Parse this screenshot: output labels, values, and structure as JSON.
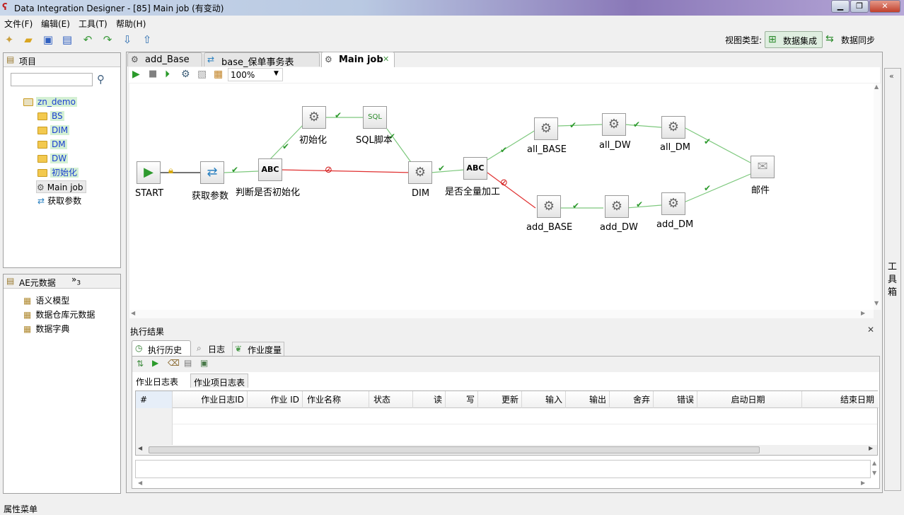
{
  "window": {
    "title": "Data Integration Designer - [85] Main job (有变动)",
    "minimize": "▁",
    "maximize": "❐",
    "close": "✕"
  },
  "menu": [
    "文件(F)",
    "编辑(E)",
    "工具(T)",
    "帮助(H)"
  ],
  "toolbar": {
    "view_type_label": "视图类型:",
    "view_integration": "数据集成",
    "view_sync": "数据同步"
  },
  "project_panel": {
    "title": "项目",
    "search_placeholder": "",
    "root": "zn_demo",
    "items": [
      "BS",
      "DIM",
      "DM",
      "DW",
      "初始化",
      "Main job",
      "获取参数"
    ]
  },
  "meta_panel": {
    "title": "AE元数据",
    "overflow": "»",
    "overflow_count": "3",
    "items": [
      "语义模型",
      "数据仓库元数据",
      "数据字典"
    ]
  },
  "editor_tabs": [
    "add_Base",
    "base_保单事务表",
    "Main job"
  ],
  "editor_toolbar": {
    "zoom": "100%"
  },
  "job_nodes": {
    "start": "START",
    "get_params": "获取参数",
    "judge_init": "判断是否初始化",
    "init": "初始化",
    "sql": "SQL脚本",
    "dim": "DIM",
    "full_process": "是否全量加工",
    "all_base": "all_BASE",
    "all_dw": "all_DW",
    "all_dm": "all_DM",
    "add_base": "add_BASE",
    "add_dw": "add_DW",
    "add_dm": "add_DM",
    "mail": "邮件"
  },
  "toolbox": "工具箱",
  "results": {
    "title": "执行结果",
    "tabs": [
      "执行历史",
      "日志",
      "作业度量"
    ],
    "subtabs": [
      "作业日志表",
      "作业项日志表"
    ],
    "columns": [
      "#",
      "作业日志ID",
      "作业 ID",
      "作业名称",
      "状态",
      "读",
      "写",
      "更新",
      "输入",
      "输出",
      "舍弃",
      "错误",
      "启动日期",
      "结束日期"
    ]
  },
  "statusbar": "属性菜单",
  "colors": {
    "ok": "#2e9a2e",
    "fail": "#d01010",
    "accent": "#6a9a6a"
  }
}
